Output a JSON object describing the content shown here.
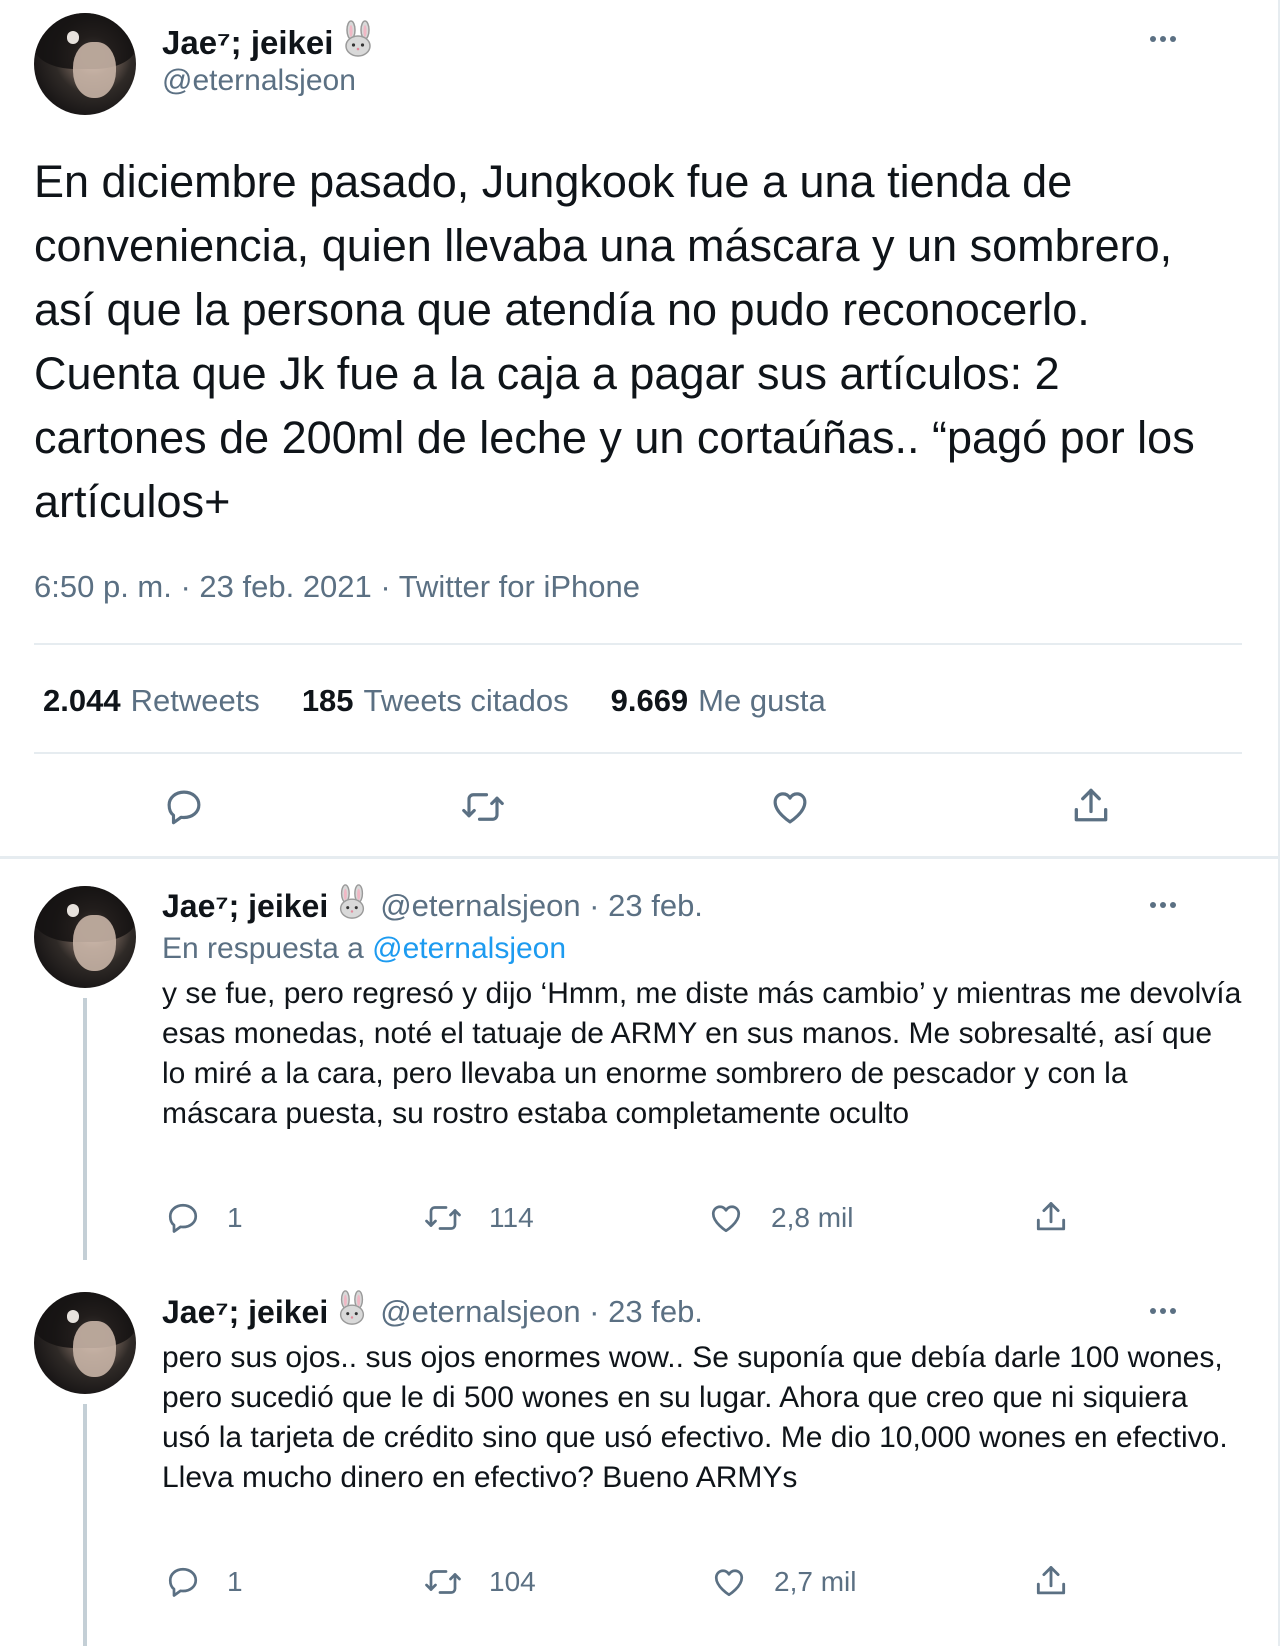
{
  "main_tweet": {
    "display_name": "Jae⁷; jeikei",
    "handle": "@eternalsjeon",
    "text": "En diciembre pasado, Jungkook fue a una tienda de conveniencia, quien llevaba una máscara y un sombrero, así que la persona que atendía no pudo reconocerlo. Cuenta que Jk fue a la caja a pagar sus artículos: 2 cartones de 200ml de leche y un cortaúñas.. “pagó por los artículos+",
    "meta": "6:50 p. m. · 23 feb. 2021 · Twitter for iPhone",
    "stats": {
      "retweets_count": "2.044",
      "retweets_label": "Retweets",
      "quotes_count": "185",
      "quotes_label": "Tweets citados",
      "likes_count": "9.669",
      "likes_label": "Me gusta"
    }
  },
  "replies": [
    {
      "display_name": "Jae⁷; jeikei",
      "handle": "@eternalsjeon · 23 feb.",
      "reply_to_prefix": "En respuesta a",
      "reply_to_mention": "@eternalsjeon",
      "text": "y se fue, pero regresó y dijo ‘Hmm, me diste más cambio’ y mientras me devolvía esas monedas, noté el tatuaje de ARMY en sus manos. Me sobresalté, así que lo miré a la cara, pero llevaba un enorme sombrero de pescador y con la máscara puesta, su rostro estaba completamente oculto",
      "reply_count": "1",
      "retweet_count": "114",
      "like_count": "2,8 mil"
    },
    {
      "display_name": "Jae⁷; jeikei",
      "handle": "@eternalsjeon · 23 feb.",
      "text": "pero sus ojos.. sus ojos enormes wow.. Se suponía que debía darle 100 wones, pero sucedió que le di 500 wones en su lugar. Ahora que creo que ni siquiera usó la tarjeta de crédito sino que usó efectivo. Me dio 10,000 wones en efectivo. Lleva mucho dinero en efectivo? Bueno ARMYs",
      "reply_count": "1",
      "retweet_count": "104",
      "like_count": "2,7 mil"
    }
  ],
  "icons": {
    "bunny": "rabbit-emoji",
    "reply": "speech-bubble-icon",
    "retweet": "retweet-arrows-icon",
    "like": "heart-outline-icon",
    "share": "share-upload-icon",
    "more": "ellipsis-icon"
  },
  "colors": {
    "text_primary": "#0f1419",
    "text_secondary": "#5b7083",
    "link": "#1d9bf0",
    "divider": "#e6ecf0",
    "thread_line": "#c4cfd6"
  }
}
